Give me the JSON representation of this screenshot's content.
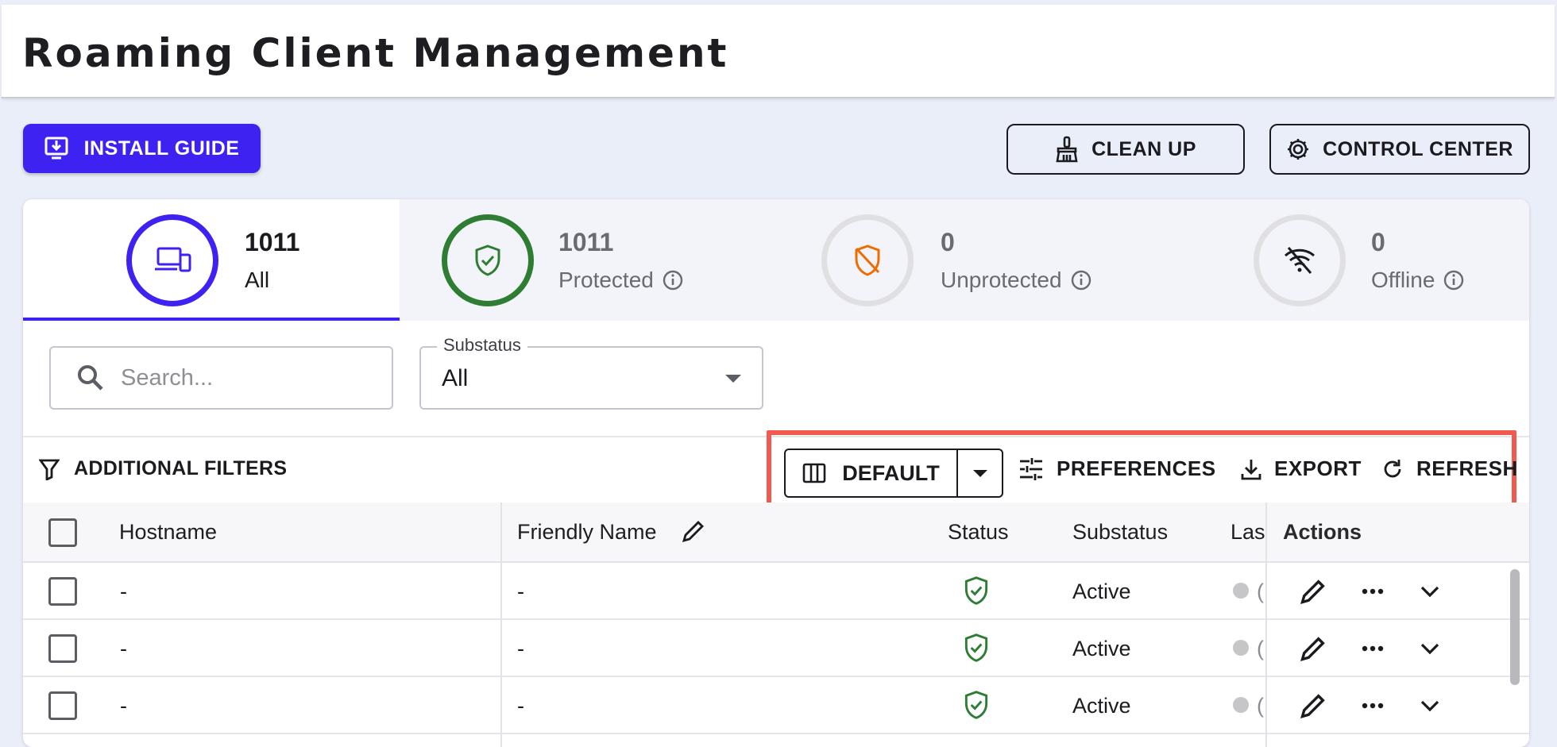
{
  "page": {
    "title": "Roaming Client Management"
  },
  "top_actions": {
    "install_guide": "INSTALL GUIDE",
    "clean_up": "CLEAN UP",
    "control_center": "CONTROL CENTER"
  },
  "stats": [
    {
      "count": "1011",
      "label": "All",
      "icon": "devices-icon",
      "color": "#3d22f2"
    },
    {
      "count": "1011",
      "label": "Protected",
      "icon": "shield-check-icon",
      "color": "#2e7d32"
    },
    {
      "count": "0",
      "label": "Unprotected",
      "icon": "shield-off-icon",
      "color": "#ef6c00"
    },
    {
      "count": "0",
      "label": "Offline",
      "icon": "wifi-off-icon",
      "color": "#1b1b1f"
    }
  ],
  "search": {
    "placeholder": "Search...",
    "value": ""
  },
  "substatus_filter": {
    "label": "Substatus",
    "value": "All"
  },
  "toolbar": {
    "additional_filters": "ADDITIONAL FILTERS",
    "view": "DEFAULT",
    "preferences": "PREFERENCES",
    "export": "EXPORT",
    "refresh": "REFRESH"
  },
  "table": {
    "columns": [
      "Hostname",
      "Friendly Name",
      "Status",
      "Substatus",
      "Las",
      "Actions"
    ],
    "rows": [
      {
        "hostname": "-",
        "friendly_name": "-",
        "status": "protected",
        "substatus": "Active",
        "last": "("
      },
      {
        "hostname": "-",
        "friendly_name": "-",
        "status": "protected",
        "substatus": "Active",
        "last": "("
      },
      {
        "hostname": "-",
        "friendly_name": "-",
        "status": "protected",
        "substatus": "Active",
        "last": "("
      }
    ]
  },
  "colors": {
    "primary": "#3d22f2",
    "protected": "#2e7d32",
    "unprotected": "#ef6c00",
    "highlight": "#f25a4f"
  }
}
